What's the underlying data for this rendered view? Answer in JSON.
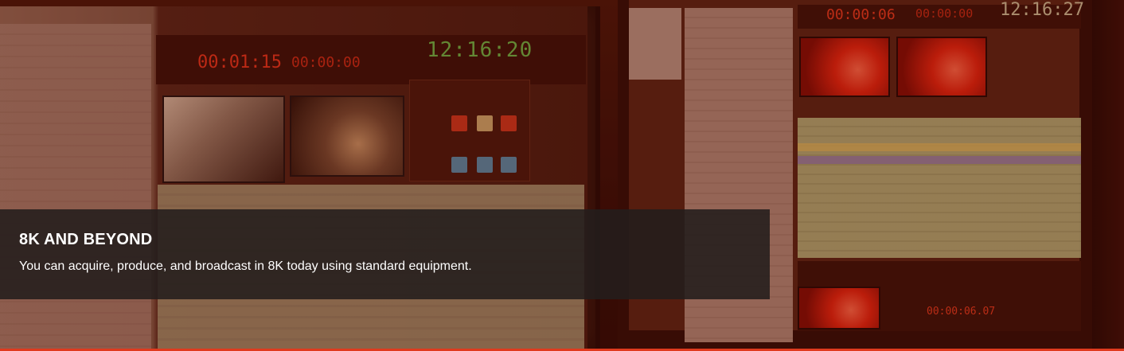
{
  "slide": {
    "title": "8K AND BEYOND",
    "description": "You can acquire, produce, and broadcast in 8K today using standard equipment."
  },
  "monitor_left": {
    "clock": "12:16:20",
    "countdown": "00:01:15",
    "item_time": "00:00:00"
  },
  "monitor_right": {
    "clock": "12:16:27",
    "countdown": "00:00:06",
    "item_time": "00:00:00",
    "bottom_counter": "00:00:06.07"
  },
  "colors": {
    "accent": "#e03a1e",
    "caption_bg": "#231e1c",
    "clock_green": "#5fbf4a"
  }
}
